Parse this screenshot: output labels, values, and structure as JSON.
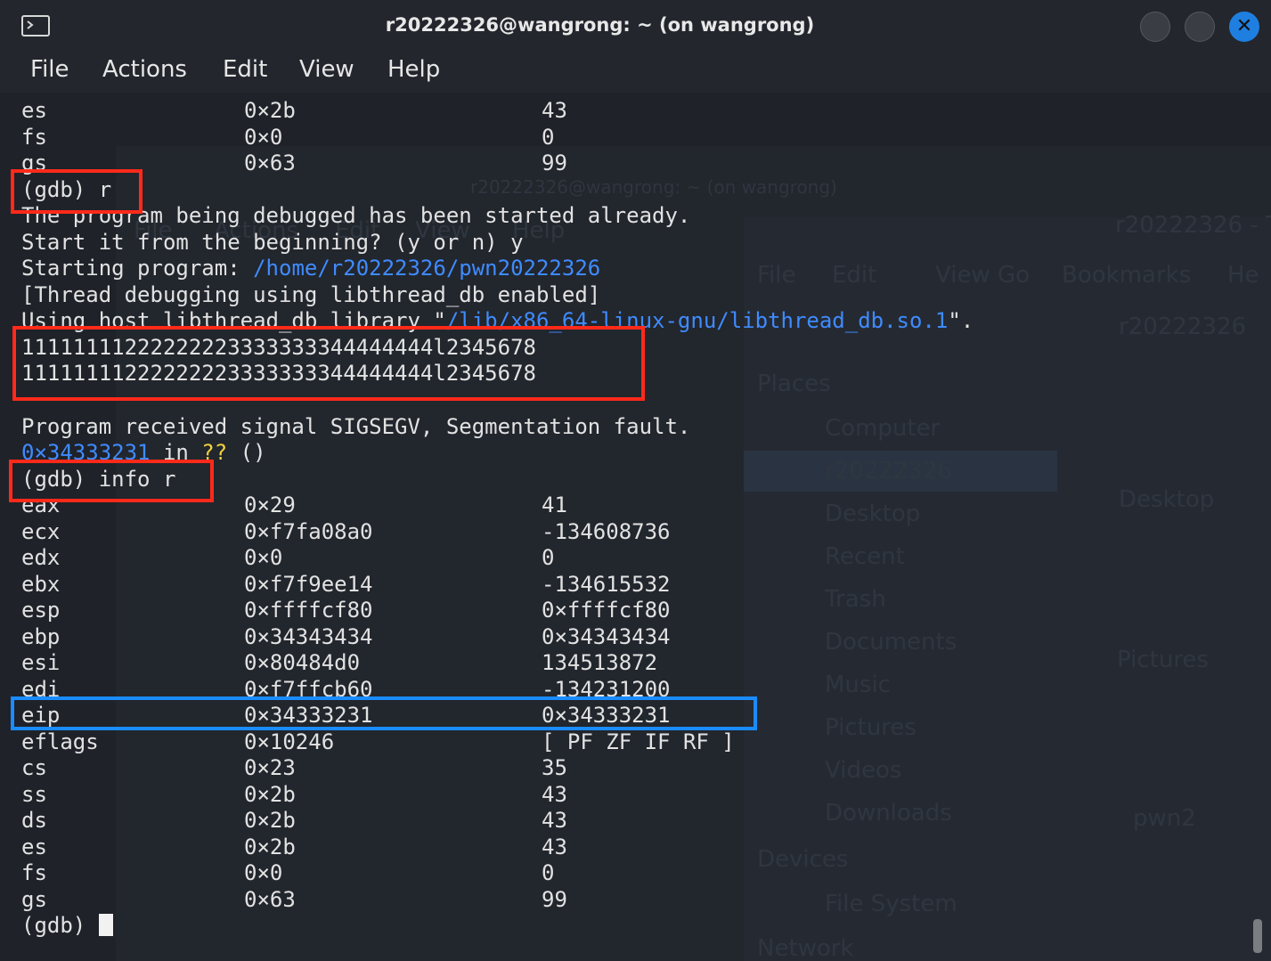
{
  "window": {
    "title": "r20222326@wangrong: ~ (on wangrong)",
    "close_glyph": "✕"
  },
  "menu": {
    "file": "File",
    "actions": "Actions",
    "edit": "Edit",
    "view": "View",
    "help": "Help"
  },
  "background_window": {
    "title": "r20222326@wangrong: ~ (on wangrong)",
    "menu": [
      "File",
      "Actions",
      "Edit",
      "View",
      "Help"
    ],
    "fm_title": "r20222326 - T",
    "fm_menu": [
      "File",
      "Edit",
      "View",
      "Go",
      "Bookmarks",
      "He"
    ],
    "path": "r20222326",
    "places_header": "Places",
    "places": [
      "Computer",
      "r20222326",
      "Desktop",
      "Recent",
      "Trash",
      "Documents",
      "Music",
      "Pictures",
      "Videos",
      "Downloads"
    ],
    "devices_header": "Devices",
    "devices": [
      "File System"
    ],
    "network_header": "Network",
    "icons": [
      "Desktop",
      "Pictures",
      "pwn2"
    ]
  },
  "terminal": {
    "regs_top": [
      {
        "name": "es",
        "hex": "0×2b",
        "val": "43"
      },
      {
        "name": "fs",
        "hex": "0×0",
        "val": "0"
      },
      {
        "name": "gs",
        "hex": "0×63",
        "val": "99"
      }
    ],
    "cmd_run": "(gdb) r",
    "started_msg": "The program being debugged has been started already.",
    "restart_question": "Start it from the beginning? (y or n) y",
    "starting_label": "Starting program: ",
    "starting_path": "/home/r20222326/pwn20222326",
    "thread_msg": "[Thread debugging using libthread_db enabled]",
    "host_label": "Using host libthread_db library \"",
    "host_path": "/lib/x86_64-linux-gnu/libthread_db.so.1",
    "host_end": "\".",
    "output_lines": [
      "11111111222222223333333344444444l2345678",
      "11111111222222223333333344444444l2345678"
    ],
    "signal_msg": "Program received signal SIGSEGV, Segmentation fault.",
    "fault_addr": "0×34333231",
    "fault_in": " in ",
    "fault_fn": "??",
    "fault_args": " ()",
    "cmd_info": "(gdb) info r",
    "regs": [
      {
        "name": "eax",
        "hex": "0×29",
        "val": "41"
      },
      {
        "name": "ecx",
        "hex": "0×f7fa08a0",
        "val": "-134608736"
      },
      {
        "name": "edx",
        "hex": "0×0",
        "val": "0"
      },
      {
        "name": "ebx",
        "hex": "0×f7f9ee14",
        "val": "-134615532"
      },
      {
        "name": "esp",
        "hex": "0×ffffcf80",
        "val": "0×ffffcf80"
      },
      {
        "name": "ebp",
        "hex": "0×34343434",
        "val": "0×34343434"
      },
      {
        "name": "esi",
        "hex": "0×80484d0",
        "val": "134513872"
      },
      {
        "name": "edi",
        "hex": "0×f7ffcb60",
        "val": "-134231200"
      },
      {
        "name": "eip",
        "hex": "0×34333231",
        "val": "0×34333231"
      },
      {
        "name": "eflags",
        "hex": "0×10246",
        "val": "[ PF ZF IF RF ]"
      },
      {
        "name": "cs",
        "hex": "0×23",
        "val": "35"
      },
      {
        "name": "ss",
        "hex": "0×2b",
        "val": "43"
      },
      {
        "name": "ds",
        "hex": "0×2b",
        "val": "43"
      },
      {
        "name": "es",
        "hex": "0×2b",
        "val": "43"
      },
      {
        "name": "fs",
        "hex": "0×0",
        "val": "0"
      },
      {
        "name": "gs",
        "hex": "0×63",
        "val": "99"
      }
    ],
    "prompt": "(gdb) "
  },
  "colors": {
    "background": "#1f2229",
    "text": "#e2e2e2",
    "path_blue": "#3f8bff",
    "annotation_red": "#ff2a1a",
    "annotation_blue": "#1a8cff"
  }
}
